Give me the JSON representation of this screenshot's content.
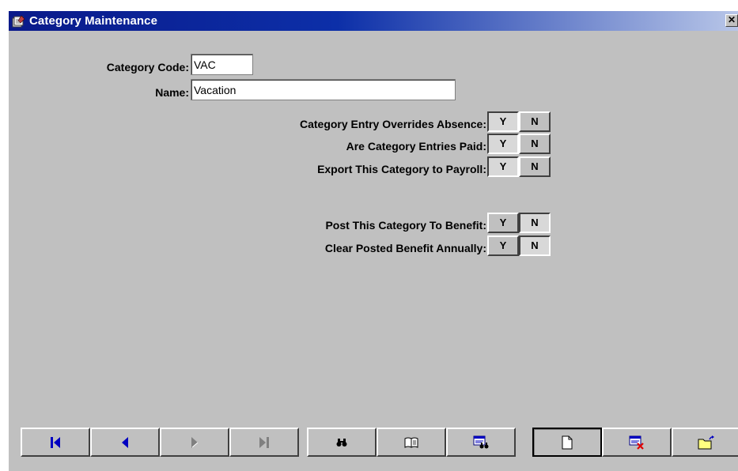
{
  "window": {
    "title": "Category Maintenance",
    "close_glyph": "✕"
  },
  "form": {
    "category_code": {
      "label": "Category Code:",
      "value": "VAC"
    },
    "name": {
      "label": "Name:",
      "value": "Vacation"
    }
  },
  "toggles": [
    {
      "label": "Category Entry Overrides Absence:",
      "yes": "Y",
      "no": "N",
      "selected": "Y"
    },
    {
      "label": "Are Category Entries Paid:",
      "yes": "Y",
      "no": "N",
      "selected": "Y"
    },
    {
      "label": "Export This Category to Payroll:",
      "yes": "Y",
      "no": "N",
      "selected": "Y"
    },
    {
      "label": "Post This Category To Benefit:",
      "yes": "Y",
      "no": "N",
      "selected": "N"
    },
    {
      "label": "Clear Posted Benefit Annually:",
      "yes": "Y",
      "no": "N",
      "selected": "N"
    }
  ],
  "colors": {
    "titlebar_start": "#0a1a8a",
    "face": "#c0c0c0",
    "nav_blue": "#0000c0",
    "nav_disabled": "#808080"
  },
  "toolbar": {
    "nav": [
      {
        "icon": "first-record-icon",
        "enabled": true
      },
      {
        "icon": "previous-record-icon",
        "enabled": true
      },
      {
        "icon": "next-record-icon",
        "enabled": false
      },
      {
        "icon": "last-record-icon",
        "enabled": false
      }
    ],
    "search": [
      {
        "icon": "binoculars-icon"
      },
      {
        "icon": "book-icon"
      },
      {
        "icon": "find-record-icon"
      }
    ],
    "actions": [
      {
        "icon": "new-document-icon"
      },
      {
        "icon": "delete-record-icon"
      },
      {
        "icon": "open-folder-icon"
      }
    ]
  }
}
